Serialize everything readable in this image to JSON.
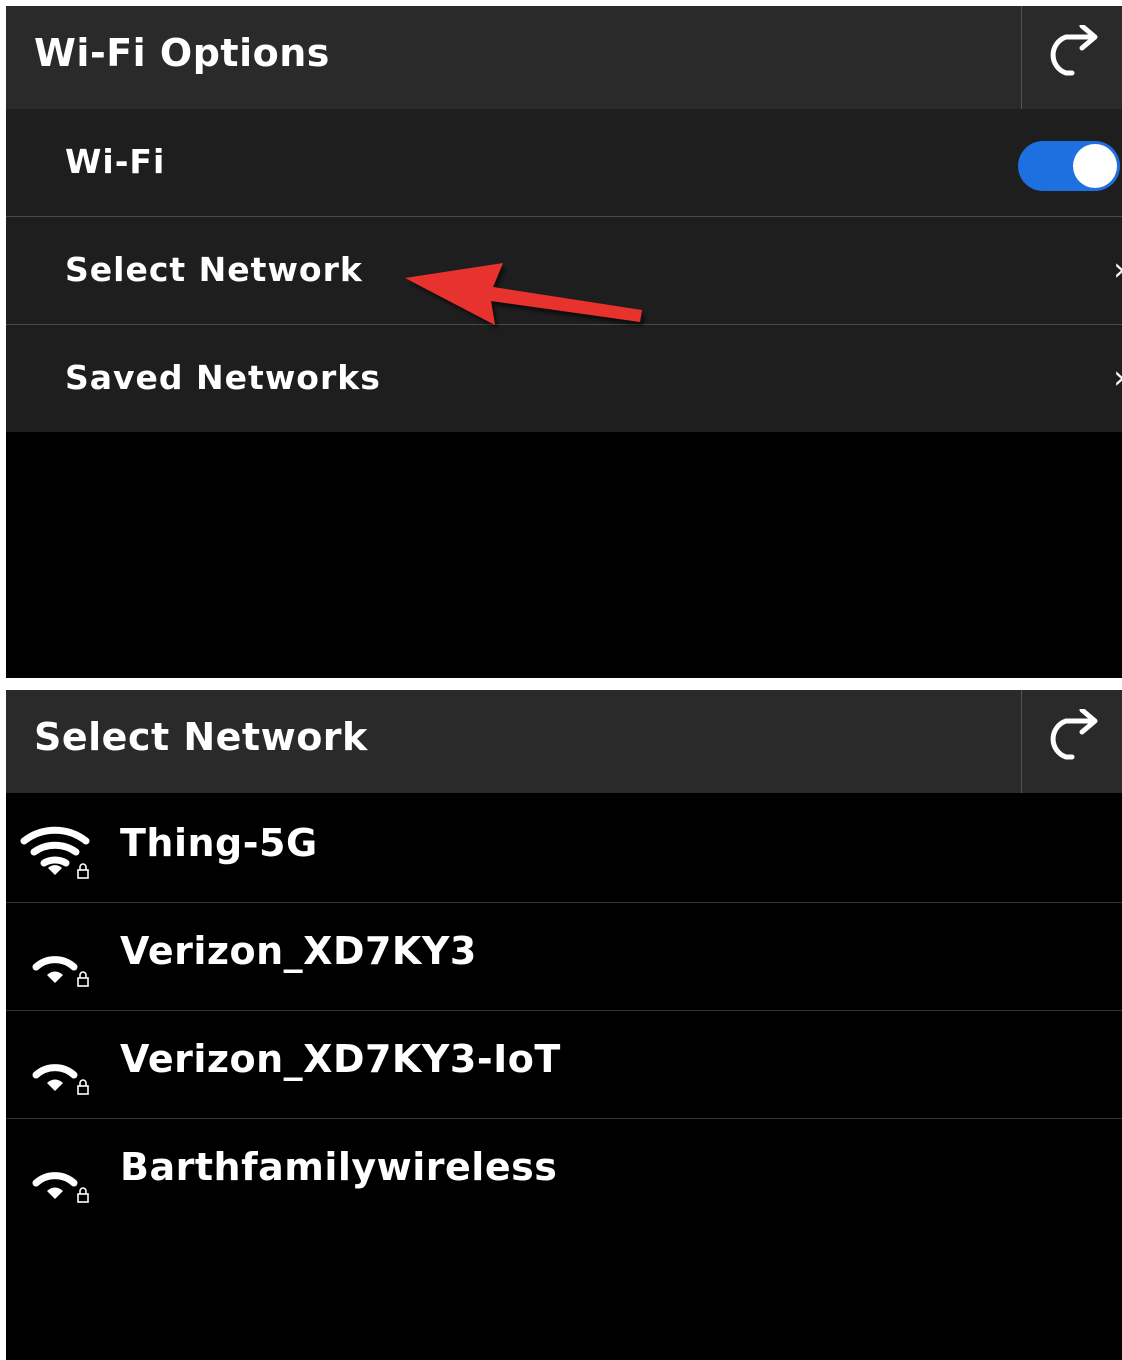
{
  "colors": {
    "toggle_on": "#1e6fe0",
    "annotation_arrow": "#e8312f"
  },
  "wifi_options": {
    "title": "Wi-Fi Options",
    "back_icon": "back-arrow-icon",
    "rows": [
      {
        "label": "Wi-Fi",
        "control": "toggle",
        "state": "on"
      },
      {
        "label": "Select Network",
        "chevron": "›",
        "annotated": true
      },
      {
        "label": "Saved Networks",
        "chevron": "›"
      }
    ]
  },
  "select_network": {
    "title": "Select Network",
    "back_icon": "back-arrow-icon",
    "networks": [
      {
        "name": "Thing-5G",
        "signal_bars": 3,
        "locked": true
      },
      {
        "name": "Verizon_XD7KY3",
        "signal_bars": 2,
        "locked": true
      },
      {
        "name": "Verizon_XD7KY3-IoT",
        "signal_bars": 2,
        "locked": true
      },
      {
        "name": "Barthfamilywireless",
        "signal_bars": 2,
        "locked": true
      }
    ]
  }
}
